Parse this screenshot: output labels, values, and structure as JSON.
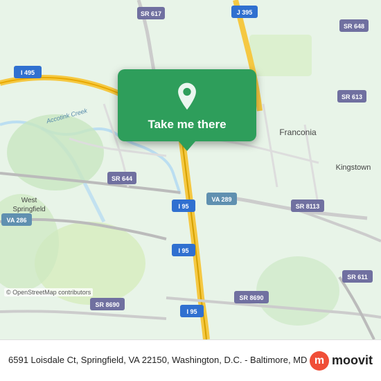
{
  "map": {
    "background_color": "#e8f0e0",
    "attribution": "© OpenStreetMap contributors"
  },
  "popup": {
    "label": "Take me there",
    "pin_color": "#ffffff"
  },
  "bottom_bar": {
    "address": "6591 Loisdale Ct, Springfield, VA 22150, Washington, D.C. - Baltimore, MD",
    "moovit_text": "moovit"
  },
  "road_labels": [
    {
      "id": "i495",
      "text": "I 495"
    },
    {
      "id": "sr617",
      "text": "SR 617"
    },
    {
      "id": "j395",
      "text": "J 395"
    },
    {
      "id": "sr648",
      "text": "SR 648"
    },
    {
      "id": "sr613",
      "text": "SR 613"
    },
    {
      "id": "sr644",
      "text": "SR 644"
    },
    {
      "id": "sr8113",
      "text": "SR 8113"
    },
    {
      "id": "i95_1",
      "text": "I 95"
    },
    {
      "id": "va289",
      "text": "VA 289"
    },
    {
      "id": "i95_2",
      "text": "I 95"
    },
    {
      "id": "va286",
      "text": "VA 286"
    },
    {
      "id": "sr8690_1",
      "text": "SR 8690"
    },
    {
      "id": "sr8690_2",
      "text": "SR 8690"
    },
    {
      "id": "sr611",
      "text": "SR 611"
    },
    {
      "id": "i95_3",
      "text": "I 95"
    },
    {
      "id": "franconia",
      "text": "Franconia"
    },
    {
      "id": "kingstown",
      "text": "Kingstown"
    },
    {
      "id": "west_springfield",
      "text": "West Springfield"
    },
    {
      "id": "accotink",
      "text": "Accotink Creek"
    }
  ]
}
